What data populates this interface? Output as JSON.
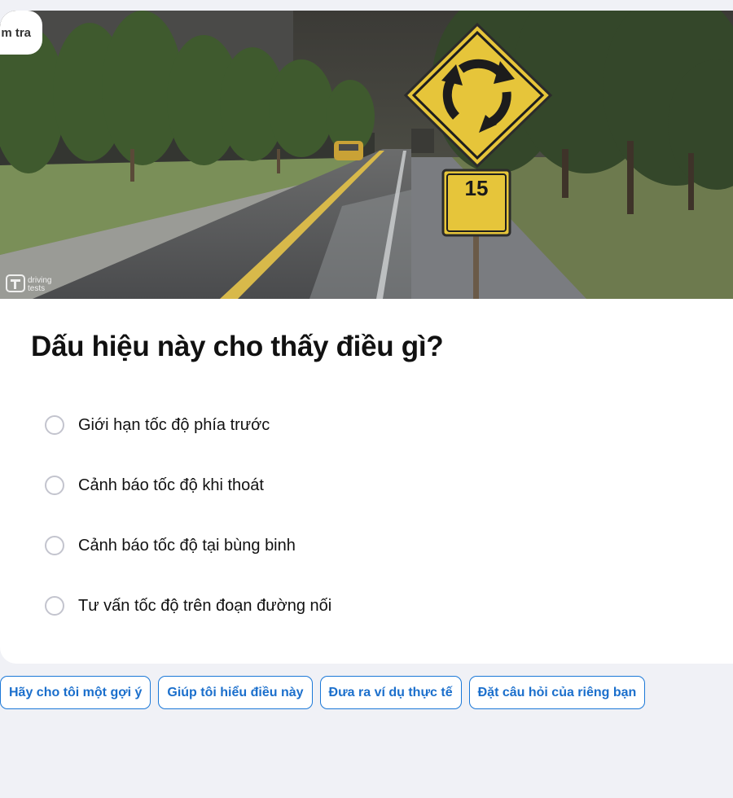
{
  "top_tab": {
    "label": "m tra"
  },
  "hero": {
    "watermark_line1": "driving",
    "watermark_line2": "tests",
    "sign_plate_number": "15"
  },
  "question": {
    "text": "Dấu hiệu này cho thấy điều gì?"
  },
  "options": [
    {
      "label": "Giới hạn tốc độ phía trước"
    },
    {
      "label": "Cảnh báo tốc độ khi thoát"
    },
    {
      "label": "Cảnh báo tốc độ tại bùng binh"
    },
    {
      "label": "Tư vấn tốc độ trên đoạn đường nối"
    }
  ],
  "chips": [
    {
      "label": "Hãy cho tôi một gợi ý"
    },
    {
      "label": "Giúp tôi hiểu điều này"
    },
    {
      "label": "Đưa ra ví dụ thực tế"
    },
    {
      "label": "Đặt câu hỏi của riêng bạn"
    }
  ],
  "colors": {
    "accent": "#1b78d8",
    "sign_yellow": "#e6c53a",
    "page_bg": "#f0f1f6"
  }
}
